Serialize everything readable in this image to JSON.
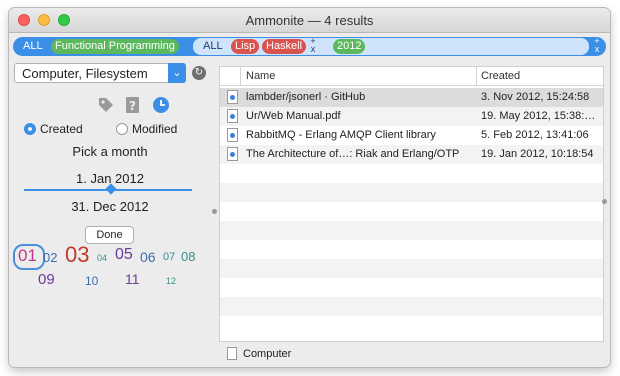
{
  "window": {
    "title": "Ammonite — 4 results"
  },
  "tokens": {
    "group1": {
      "all_label": "ALL",
      "items": [
        {
          "label": "Functional Programming",
          "color": "#5cb85c"
        }
      ]
    },
    "group2": {
      "all_label": "ALL",
      "items": [
        {
          "label": "Lisp",
          "color": "#d9534f"
        },
        {
          "label": "Haskell",
          "color": "#d9534f"
        }
      ]
    },
    "group3": {
      "items": [
        {
          "label": "2012",
          "color": "#5cb85c"
        }
      ]
    },
    "add_label": "+",
    "remove_label": "x"
  },
  "sidebar": {
    "location": {
      "value": "Computer, Filesystem",
      "arrow": "⌄"
    },
    "refresh_icon": "↻",
    "icons": [
      "tag-icon",
      "unknown-kind-icon",
      "clock-icon"
    ],
    "date_mode": {
      "created_label": "Created",
      "modified_label": "Modified",
      "selected": "Created"
    },
    "heading": "Pick a month",
    "start_date": "1. Jan 2012",
    "end_date": "31. Dec 2012",
    "done_label": "Done",
    "months": [
      "01",
      "02",
      "03",
      "04",
      "05",
      "06",
      "07",
      "08",
      "09",
      "10",
      "11",
      "12"
    ]
  },
  "table": {
    "columns": [
      "Name",
      "Created"
    ],
    "rows": [
      {
        "name": "lambder/jsonerl · GitHub",
        "created": "3. Nov 2012, 15:24:58"
      },
      {
        "name": "Ur/Web Manual.pdf",
        "created": "19. May 2012, 15:38:…"
      },
      {
        "name": "RabbitMQ - Erlang AMQP Client library",
        "created": "5. Feb 2012, 13:41:06"
      },
      {
        "name": "The Architecture of…: Riak and Erlang/OTP",
        "created": "19. Jan 2012, 10:18:54"
      }
    ],
    "selected_index": 0
  },
  "status": {
    "path": "Computer"
  },
  "colors": {
    "accent": "#3b8fe6",
    "month_pink": "#c0358f",
    "month_red": "#c0392b",
    "month_blue": "#3a6ea8",
    "month_purple": "#6b3a9a",
    "month_teal": "#3a8c8a"
  }
}
